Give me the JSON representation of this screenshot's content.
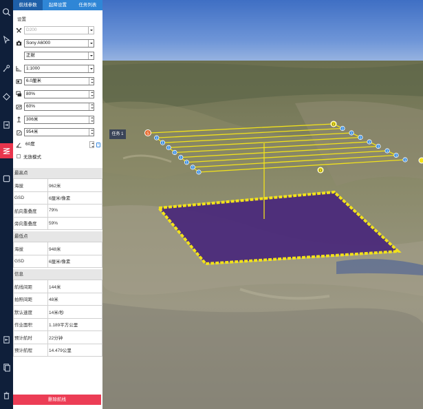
{
  "tabs": [
    {
      "label": "航线参数",
      "active": true
    },
    {
      "label": "起降设置",
      "active": false
    },
    {
      "label": "任务列表",
      "active": false
    }
  ],
  "settings": {
    "section_title": "设置",
    "drone": "D200",
    "camera": "Sony A6000",
    "shoot_mode": "正射",
    "scale": "1:1000",
    "gsd": "6.0厘米",
    "forward_overlap": "80%",
    "side_overlap": "60%",
    "altitude": "306米",
    "takeoff_height": "954米",
    "angle": "60度",
    "info_icon": "i",
    "free_mode_label": "无放模式"
  },
  "highest_point": {
    "title": "最高点",
    "rows": [
      {
        "k": "海拔",
        "v": "962米"
      },
      {
        "k": "GSD",
        "v": "6厘米/像素"
      },
      {
        "k": "航向重叠度",
        "v": "79%"
      },
      {
        "k": "旁向重叠度",
        "v": "59%"
      }
    ]
  },
  "lowest_point": {
    "title": "最低点",
    "rows": [
      {
        "k": "海拔",
        "v": "948米"
      },
      {
        "k": "GSD",
        "v": "6厘米/像素"
      }
    ]
  },
  "info": {
    "title": "信息",
    "rows": [
      {
        "k": "航线间距",
        "v": "144米"
      },
      {
        "k": "拍照间距",
        "v": "48米"
      },
      {
        "k": "默认速度",
        "v": "14米/秒"
      },
      {
        "k": "作业面积",
        "v": "1.189平方公里"
      },
      {
        "k": "预计航时",
        "v": "22分钟"
      },
      {
        "k": "预计航程",
        "v": "14.479公里"
      }
    ]
  },
  "delete_button": "删除航线",
  "map": {
    "task_label": "任务 1",
    "marker_start": "S",
    "marker_end": "D",
    "marker_waypoint": "1",
    "area_color": "#4b2a7a",
    "route_color": "#f2e21b"
  },
  "colors": {
    "toolbar_bg": "#0f1f3a",
    "tab_bar": "#2f86d6",
    "tab_active": "#1e5fa8",
    "active_tool": "#e8344c",
    "delete_button": "#ec3d55"
  },
  "toolbar_icons": [
    "search-icon",
    "select-cursor-icon",
    "point-icon",
    "polygon-icon",
    "import-icon",
    "route-icon",
    "layer-icon",
    "export-icon",
    "copy-icon",
    "trash-icon"
  ]
}
